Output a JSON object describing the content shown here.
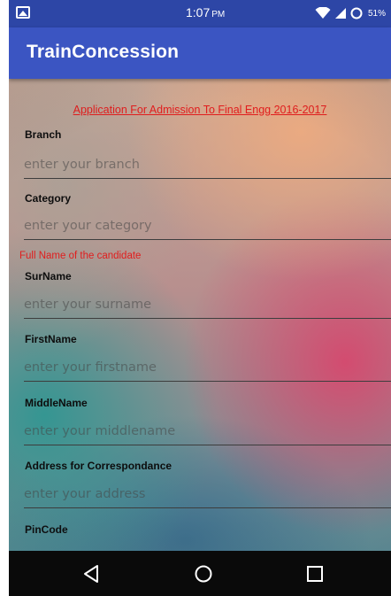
{
  "status_bar": {
    "time": "1:07",
    "time_suffix": "PM",
    "battery": "51%",
    "icons": [
      "image-icon",
      "wifi-icon",
      "signal-icon",
      "battery-icon"
    ]
  },
  "app_bar": {
    "title": "TrainConcession",
    "color": "#3b55c2"
  },
  "form": {
    "heading": "Application For Admission To Final Engg 2016-2017",
    "section_full_name": "Full Name of the candidate",
    "fields": [
      {
        "label": "Branch",
        "placeholder": "enter your branch",
        "value": ""
      },
      {
        "label": "Category",
        "placeholder": "enter your category",
        "value": ""
      },
      {
        "label": "SurName",
        "placeholder": "enter your surname",
        "value": ""
      },
      {
        "label": "FirstName",
        "placeholder": "enter your firstname",
        "value": ""
      },
      {
        "label": "MiddleName",
        "placeholder": "enter your middlename",
        "value": ""
      },
      {
        "label": "Address for Correspondance",
        "placeholder": "enter your address",
        "value": ""
      },
      {
        "label": "PinCode",
        "placeholder": "",
        "value": ""
      }
    ],
    "accent_color": "#e11d1d"
  },
  "nav_bar": {
    "buttons": [
      "back-icon",
      "home-icon",
      "recents-icon"
    ]
  }
}
